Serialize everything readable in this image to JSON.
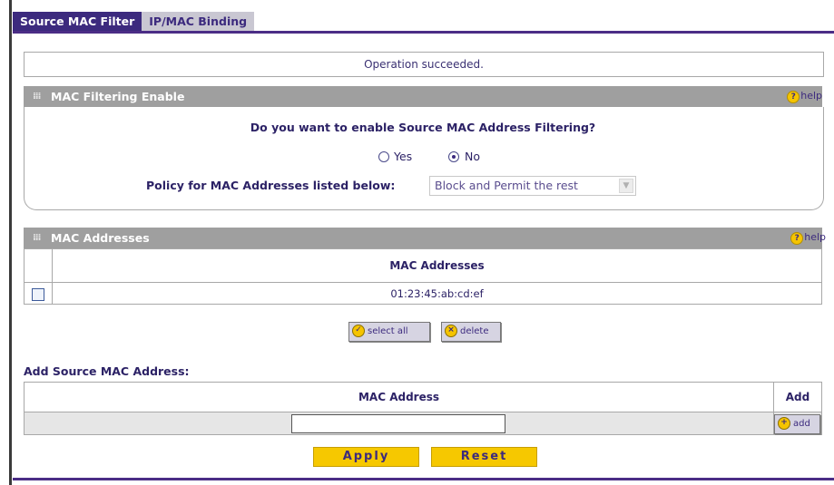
{
  "tabs": [
    {
      "label": "Source MAC Filter",
      "active": true
    },
    {
      "label": "IP/MAC Binding",
      "active": false
    }
  ],
  "status_message": "Operation succeeded.",
  "mac_filtering": {
    "header": "MAC Filtering Enable",
    "help_label": "help",
    "question": "Do you want to enable Source MAC Address Filtering?",
    "options": [
      {
        "label": "Yes",
        "checked": false
      },
      {
        "label": "No",
        "checked": true
      }
    ],
    "policy_label": "Policy for MAC Addresses listed below:",
    "policy_value": "Block and Permit the rest"
  },
  "mac_addresses": {
    "header": "MAC Addresses",
    "help_label": "help",
    "column_header": "MAC Addresses",
    "rows": [
      {
        "mac": "01:23:45:ab:cd:ef",
        "checked": false
      }
    ],
    "select_all_label": "select all",
    "delete_label": "delete"
  },
  "add_section": {
    "title": "Add Source MAC Address:",
    "mac_header": "MAC Address",
    "add_header": "Add",
    "mac_value": "",
    "add_button_label": "add"
  },
  "footer": {
    "apply_label": "Apply",
    "reset_label": "Reset"
  },
  "colors": {
    "accent_purple": "#3c2a7e",
    "section_header_gray": "#9f9f9f",
    "button_yellow": "#f6c800"
  }
}
